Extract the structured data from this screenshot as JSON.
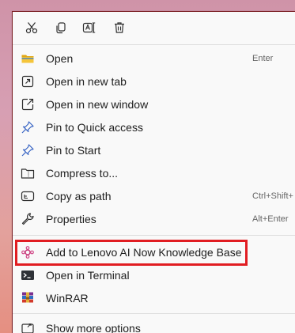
{
  "toolbar": {
    "icons": [
      "scissors-icon",
      "copy-icon",
      "rename-icon",
      "trash-icon"
    ]
  },
  "menu": {
    "items": [
      {
        "label": "Open",
        "shortcut": "Enter",
        "icon": "folder-icon"
      },
      {
        "label": "Open in new tab",
        "icon": "new-tab-icon"
      },
      {
        "label": "Open in new window",
        "icon": "new-window-icon"
      },
      {
        "label": "Pin to Quick access",
        "icon": "pin-icon"
      },
      {
        "label": "Pin to Start",
        "icon": "pin-icon"
      },
      {
        "label": "Compress to...",
        "icon": "compress-icon"
      },
      {
        "label": "Copy as path",
        "shortcut": "Ctrl+Shift+",
        "icon": "copy-path-icon"
      },
      {
        "label": "Properties",
        "shortcut": "Alt+Enter",
        "icon": "properties-icon"
      },
      {
        "label": "Add to Lenovo AI Now Knowledge Base",
        "icon": "lenovo-ai-icon"
      },
      {
        "label": "Open in Terminal",
        "icon": "terminal-icon"
      },
      {
        "label": "WinRAR",
        "icon": "winrar-icon"
      },
      {
        "label": "Show more options",
        "icon": "more-options-icon"
      }
    ]
  },
  "colors": {
    "menu_background": "#f9f9f9",
    "highlight_border": "#e11d22",
    "text": "#202020",
    "shortcut_text": "#666666"
  }
}
